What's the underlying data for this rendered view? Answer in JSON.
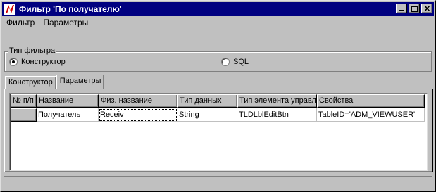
{
  "window": {
    "title": "Фильтр 'По получателю'",
    "icon": "app-logo-icon",
    "controls": [
      "minimize-icon",
      "maximize-icon",
      "close-icon"
    ]
  },
  "menu": {
    "items": [
      "Фильтр",
      "Параметры"
    ]
  },
  "filter_type": {
    "label": "Тип фильтра",
    "options": [
      {
        "label": "Конструктор",
        "selected": true
      },
      {
        "label": "SQL",
        "selected": false
      }
    ]
  },
  "tabs": [
    {
      "label": "Конструктор",
      "active": false
    },
    {
      "label": "Параметры",
      "active": true
    }
  ],
  "grid": {
    "columns": [
      "№ п/п",
      "Название",
      "Физ. название",
      "Тип данных",
      "Тип элемента управл",
      "Свойства"
    ],
    "rows": [
      {
        "num": "",
        "cells": [
          "Получатель",
          "Receiv",
          "String",
          "TLDLblEditBtn",
          "TableID='ADM_VIEWUSER'"
        ]
      }
    ]
  },
  "colors": {
    "title_bar": "#000080",
    "face": "#c0c0c0"
  }
}
